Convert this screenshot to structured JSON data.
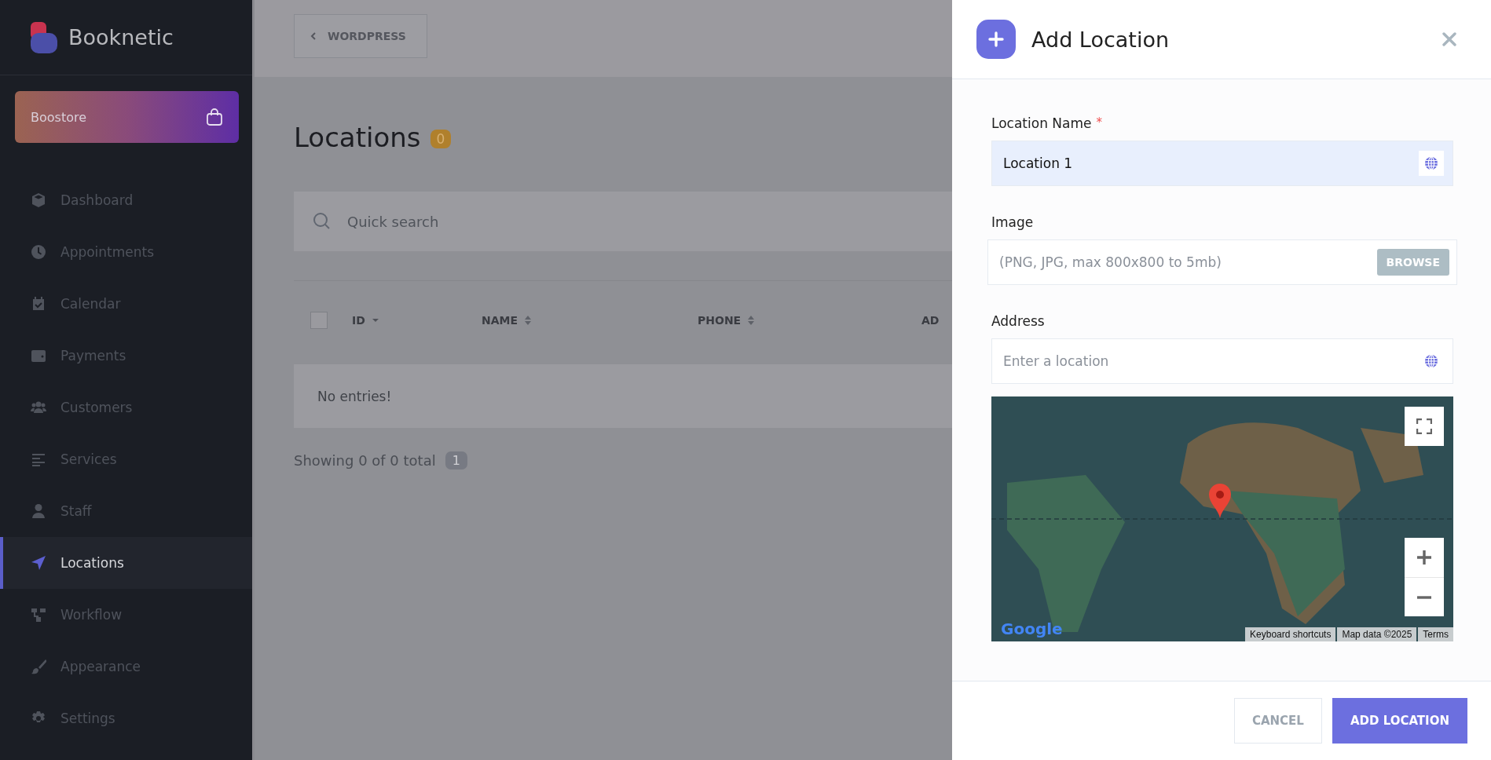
{
  "brand": {
    "name": "Booknetic"
  },
  "store_button": {
    "label": "Boostore"
  },
  "sidebar": {
    "items": [
      {
        "label": "Dashboard",
        "selected": false
      },
      {
        "label": "Appointments",
        "selected": false
      },
      {
        "label": "Calendar",
        "selected": false
      },
      {
        "label": "Payments",
        "selected": false
      },
      {
        "label": "Customers",
        "selected": false
      },
      {
        "label": "Services",
        "selected": false
      },
      {
        "label": "Staff",
        "selected": false
      },
      {
        "label": "Locations",
        "selected": true
      },
      {
        "label": "Workflow",
        "selected": false
      },
      {
        "label": "Appearance",
        "selected": false
      },
      {
        "label": "Settings",
        "selected": false
      }
    ]
  },
  "top_bar": {
    "back_button": "WORDPRESS"
  },
  "page": {
    "title": "Locations",
    "count": "0"
  },
  "search": {
    "placeholder": "Quick search"
  },
  "table": {
    "select_all": {
      "checked": false
    },
    "columns": [
      {
        "label": "ID",
        "kind": "sorted"
      },
      {
        "label": "NAME",
        "kind": "sortable"
      },
      {
        "label": "PHONE",
        "kind": "sortable"
      },
      {
        "label": "AD",
        "kind": "plain"
      }
    ],
    "empty_text": "No entries!"
  },
  "pagination": {
    "summary": "Showing 0 of 0 total",
    "pages": [
      {
        "label": "1",
        "selected": true
      }
    ]
  },
  "panel": {
    "title": "Add Location",
    "fields": [
      {
        "kind": "text",
        "label": "Location Name",
        "required_mark": "*",
        "value": "Location 1",
        "highlighted": true
      },
      {
        "kind": "file",
        "label": "Image",
        "placeholder": "(PNG, JPG, max 800x800 to 5mb)",
        "button": "BROWSE",
        "highlighted": false
      },
      {
        "kind": "text",
        "label": "Address",
        "placeholder": "Enter a location",
        "highlighted": false
      }
    ],
    "map": {
      "logo": "Google",
      "attribution": [
        "Keyboard shortcuts",
        "Map data ©2025",
        "Terms"
      ]
    },
    "buttons": [
      {
        "label": "CANCEL",
        "kind": "secondary"
      },
      {
        "label": "ADD LOCATION",
        "kind": "primary"
      }
    ]
  }
}
